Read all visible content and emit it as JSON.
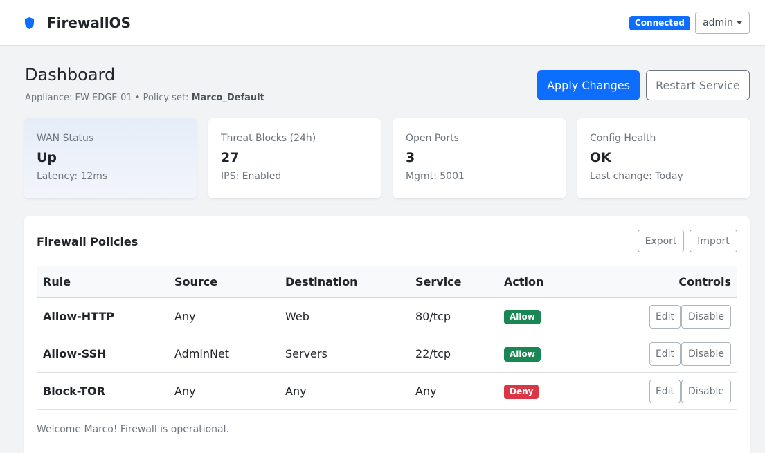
{
  "header": {
    "brand_icon": "shield-icon",
    "brand_name": "FirewallOS",
    "connection_status": "Connected",
    "user_menu_label": "admin",
    "colors": {
      "accent": "#0d6efd",
      "allow": "#198754",
      "deny": "#dc3545"
    }
  },
  "page": {
    "title": "Dashboard",
    "appliance_text": "Appliance: FW-EDGE-01 • Policy set: ",
    "policy_set": "Marco_Default",
    "apply_label": "Apply Changes",
    "restart_label": "Restart Service"
  },
  "stats": [
    {
      "label": "WAN Status",
      "value": "Up",
      "sub": "Latency: 12ms"
    },
    {
      "label": "Threat Blocks (24h)",
      "value": "27",
      "sub": "IPS: Enabled"
    },
    {
      "label": "Open Ports",
      "value": "3",
      "sub": "Mgmt: 5001"
    },
    {
      "label": "Config Health",
      "value": "OK",
      "sub": "Last change: Today"
    }
  ],
  "policies": {
    "title": "Firewall Policies",
    "export_label": "Export",
    "import_label": "Import",
    "columns": [
      "Rule",
      "Source",
      "Destination",
      "Service",
      "Action",
      "Controls"
    ],
    "rows": [
      {
        "rule": "Allow-HTTP",
        "source": "Any",
        "destination": "Web",
        "service": "80/tcp",
        "action": "Allow",
        "edit": "Edit",
        "disable": "Disable"
      },
      {
        "rule": "Allow-SSH",
        "source": "AdminNet",
        "destination": "Servers",
        "service": "22/tcp",
        "action": "Allow",
        "edit": "Edit",
        "disable": "Disable"
      },
      {
        "rule": "Block-TOR",
        "source": "Any",
        "destination": "Any",
        "service": "Any",
        "action": "Deny",
        "edit": "Edit",
        "disable": "Disable"
      }
    ],
    "welcome": "Welcome Marco! Firewall is operational."
  }
}
